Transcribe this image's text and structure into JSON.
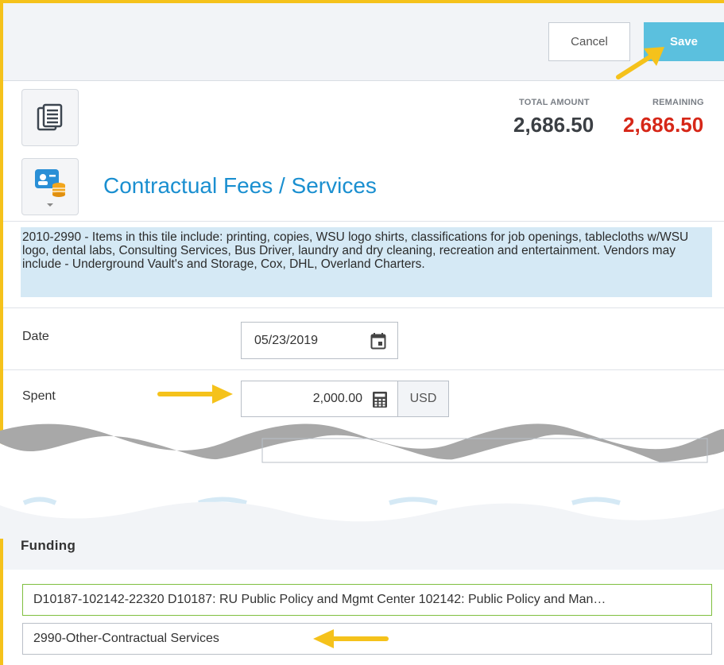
{
  "header": {
    "cancel_label": "Cancel",
    "save_label": "Save"
  },
  "totals": {
    "total_label": "TOTAL AMOUNT",
    "total_value": "2,686.50",
    "remaining_label": "REMAINING",
    "remaining_value": "2,686.50"
  },
  "category": {
    "title": "Contractual Fees / Services",
    "description": "2010-2990 - Items in this tile include: printing, copies, WSU logo shirts, classifications for job openings, tablecloths w/WSU logo, dental labs, Consulting Services, Bus Driver, laundry and dry cleaning, recreation and entertainment. Vendors may include - Underground Vault's and Storage, Cox, DHL, Overland Charters."
  },
  "form": {
    "date_label": "Date",
    "date_value": "05/23/2019",
    "spent_label": "Spent",
    "spent_value": "2,000.00",
    "currency": "USD"
  },
  "funding": {
    "header": "Funding",
    "account": "D10187-102142-22320 D10187: RU  Public Policy and Mgmt Center 102142: Public Policy and Man…",
    "object_code": "2990-Other-Contractual Services"
  },
  "colors": {
    "accent": "#1a8fd0",
    "save_button": "#5bc0de",
    "remaining": "#d62718",
    "highlight_border": "#f5c21b",
    "annotation_arrow": "#f5c21b"
  },
  "icons": {
    "document_tile": "document-list-icon",
    "category_tile": "contact-card-coins-icon",
    "date_picker": "calendar-icon",
    "amount_picker": "calculator-icon"
  }
}
